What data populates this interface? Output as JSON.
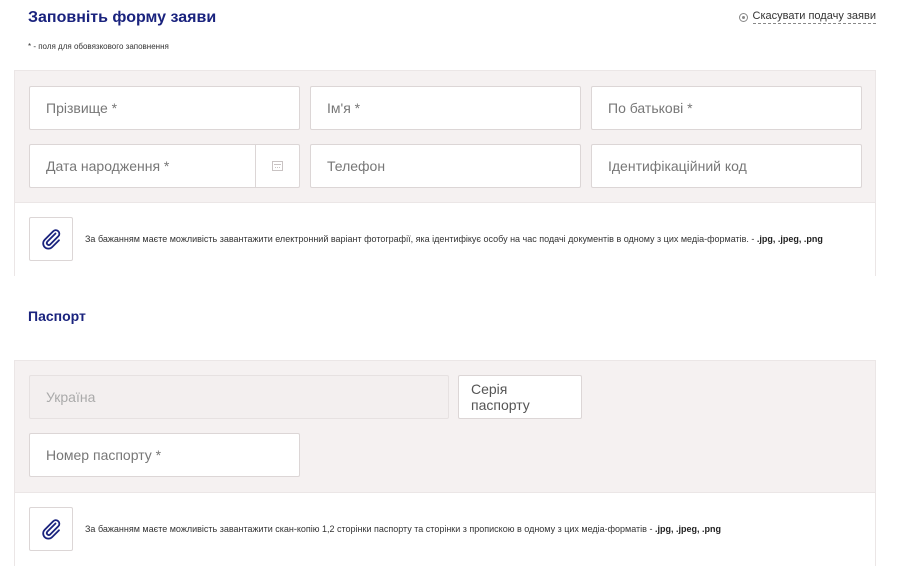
{
  "header": {
    "title": "Заповніть форму заяви",
    "cancel_label": "Скасувати подачу заяви",
    "required_note": "* - поля для обовязкового заповнення"
  },
  "personal": {
    "surname_placeholder": "Прізвище *",
    "name_placeholder": "Ім'я *",
    "patronymic_placeholder": "По батькові *",
    "birthdate_placeholder": "Дата народження *",
    "phone_placeholder": "Телефон",
    "tax_id_placeholder": "Ідентифікаційний код",
    "upload_text": "За бажанням маєте можливість завантажити електронний варіант фотографії, яка ідентифікує особу на час подачі документів в одному з цих медіа-форматів. - ",
    "upload_formats": ".jpg, .jpeg, .png"
  },
  "passport": {
    "section_title": "Паспорт",
    "country_value": "Україна",
    "series_label": "Серія паспорту",
    "number_placeholder": "Номер паспорту *",
    "upload_text": "За бажанням маєте можливість завантажити скан-копію 1,2 сторінки паспорту та сторінки з пропискою в одному з цих медіа-форматів - ",
    "upload_formats": ".jpg, .jpeg, .png"
  },
  "colors": {
    "title": "#1a237e",
    "card_bg": "#f5f1f1",
    "paperclip": "#1a237e"
  },
  "icons": {
    "cancel": "circle-dot-icon",
    "calendar": "calendar-icon",
    "attach": "paperclip-icon"
  }
}
